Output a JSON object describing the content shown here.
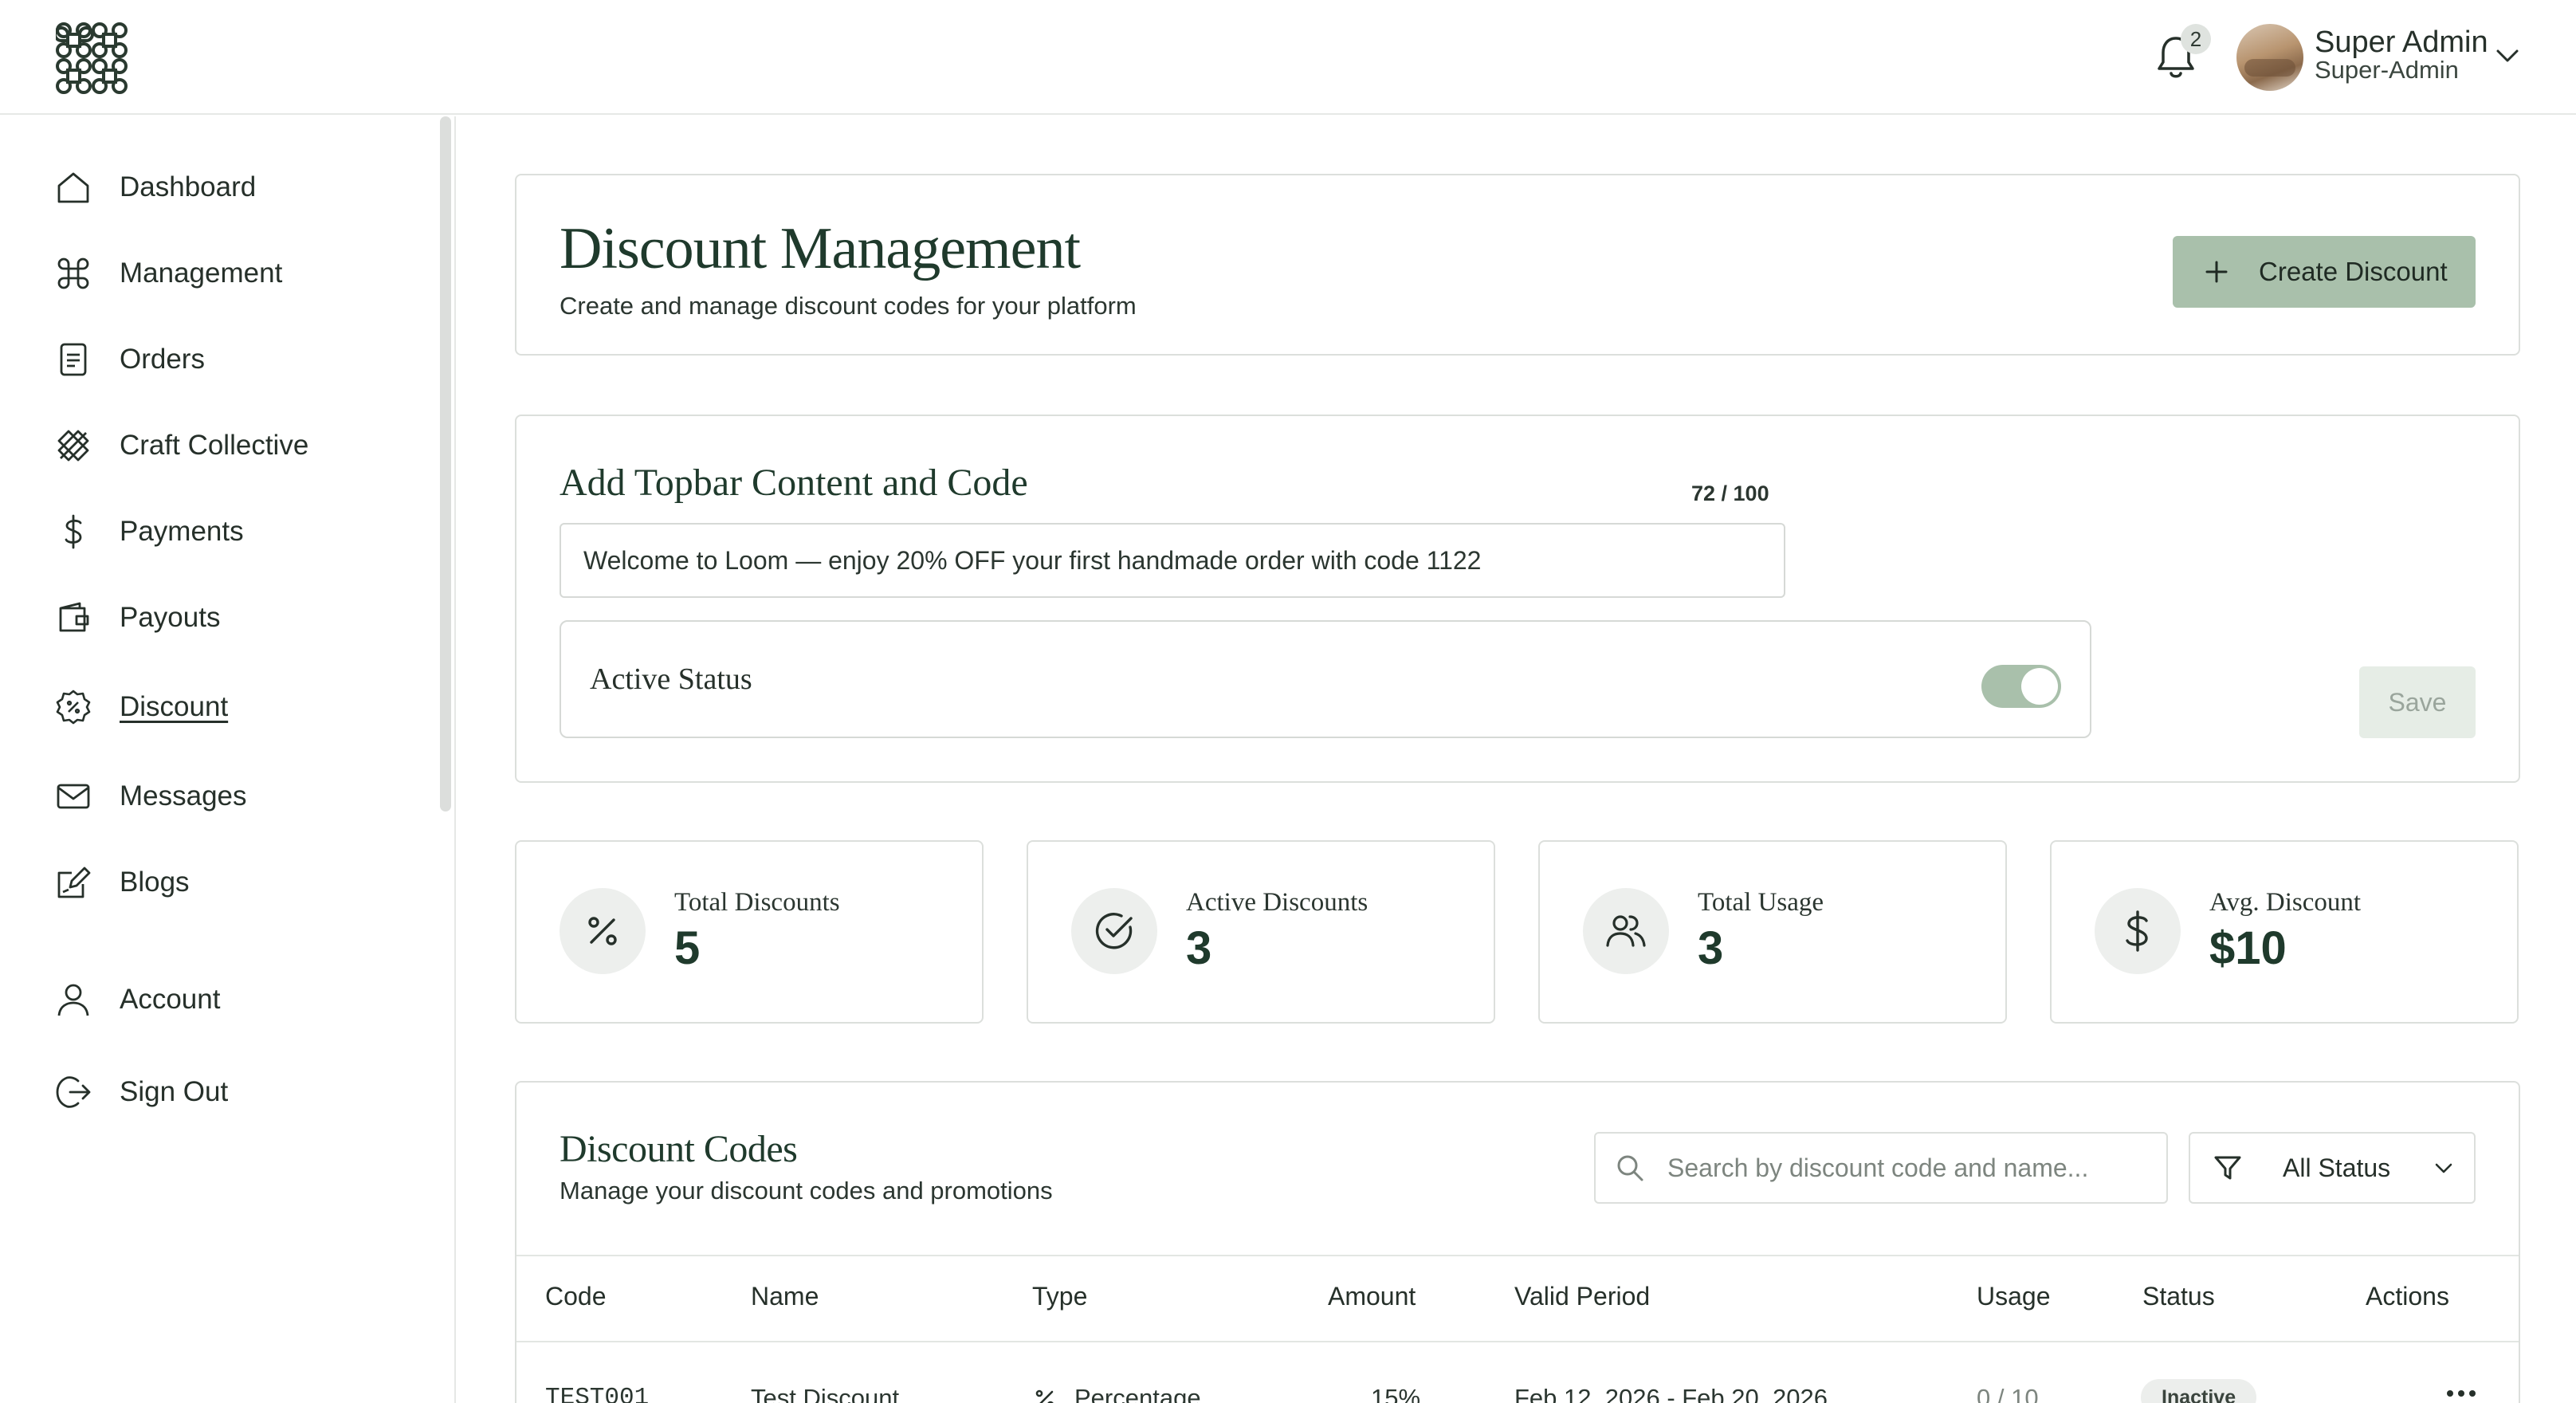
{
  "header": {
    "notification_count": "2",
    "user": {
      "name": "Super Admin",
      "role": "Super-Admin"
    }
  },
  "sidebar": {
    "items": [
      {
        "label": "Dashboard",
        "icon": "home-icon"
      },
      {
        "label": "Management",
        "icon": "command-icon"
      },
      {
        "label": "Orders",
        "icon": "document-icon"
      },
      {
        "label": "Craft Collective",
        "icon": "tools-icon"
      },
      {
        "label": "Payments",
        "icon": "dollar-icon"
      },
      {
        "label": "Payouts",
        "icon": "wallet-icon"
      },
      {
        "label": "Discount",
        "icon": "discount-badge-icon",
        "active": true
      },
      {
        "label": "Messages",
        "icon": "mail-icon"
      },
      {
        "label": "Blogs",
        "icon": "edit-icon"
      },
      {
        "label": "Account",
        "icon": "user-icon"
      },
      {
        "label": "Sign Out",
        "icon": "sign-out-icon"
      }
    ]
  },
  "page": {
    "title": "Discount Management",
    "subtitle": "Create and manage discount codes for your platform",
    "create_button": "Create Discount"
  },
  "topbar_content": {
    "title": "Add Topbar Content and Code",
    "char_count": "72 / 100",
    "value": "Welcome to Loom — enjoy 20% OFF your first handmade order with code 1122",
    "active_status_label": "Active Status",
    "active": true,
    "save_button": "Save"
  },
  "stats": [
    {
      "label": "Total Discounts",
      "value": "5",
      "icon": "percent-icon"
    },
    {
      "label": "Active Discounts",
      "value": "3",
      "icon": "check-circle-icon"
    },
    {
      "label": "Total Usage",
      "value": "3",
      "icon": "users-icon"
    },
    {
      "label": "Avg. Discount",
      "value": "$10",
      "icon": "dollar-icon"
    }
  ],
  "discount_codes": {
    "title": "Discount Codes",
    "subtitle": "Manage your discount codes and promotions",
    "search_placeholder": "Search by discount code and name...",
    "filter_value": "All Status",
    "columns": [
      "Code",
      "Name",
      "Type",
      "Amount",
      "Valid Period",
      "Usage",
      "Status",
      "Actions"
    ],
    "rows": [
      {
        "code": "TEST001",
        "name": "Test Discount",
        "type": "Percentage",
        "amount": "15%",
        "valid_period": "Feb 12, 2026 - Feb 20, 2026",
        "usage": "0 / 10",
        "status": "Inactive"
      }
    ]
  },
  "colors": {
    "accent": "#a9c0ab",
    "heading": "#1f3a2c",
    "border": "#dcdfdc"
  }
}
